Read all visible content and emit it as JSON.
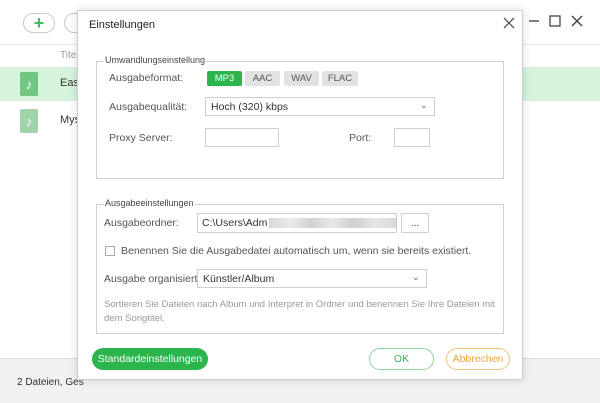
{
  "main": {
    "add_icon": "plus-icon",
    "column_title": "Titel",
    "rows": [
      {
        "name": "Easi",
        "icon": "music-note-icon"
      },
      {
        "name": "Mys",
        "icon": "music-note-icon"
      }
    ],
    "status": "2 Dateien, Ges"
  },
  "dialog": {
    "title": "Einstellungen",
    "close_icon": "close-icon",
    "conversion": {
      "legend": "Umwandlungseinstellung",
      "format_label": "Ausgabeformat:",
      "formats": [
        "MP3",
        "AAC",
        "WAV",
        "FLAC"
      ],
      "selected_format": "MP3",
      "quality_label": "Ausgabequalität:",
      "quality_value": "Hoch (320) kbps",
      "proxy_label": "Proxy Server:",
      "proxy_value": "",
      "port_label": "Port:",
      "port_value": ""
    },
    "output": {
      "legend": "Ausgabeeinstellungen",
      "folder_label": "Ausgabeordner:",
      "folder_value": "C:\\Users\\Adm",
      "browse_label": "...",
      "rename_label": "Benennen Sie die Ausgabedatei automatisch um, wenn sie bereits existiert.",
      "rename_checked": false,
      "organize_label": "Ausgabe organisiert:",
      "organize_value": "Künstler/Album",
      "organize_hint": "Sortieren Sie Dateien nach Album und Interpret in Ordner und benennen Sie Ihre Dateien mit dem Songtitel."
    },
    "buttons": {
      "defaults": "Standardeinstellungen",
      "ok": "OK",
      "cancel": "Abbrechen"
    }
  },
  "colors": {
    "accent": "#2db54d",
    "selected_row": "#d6f3dc",
    "cancel": "#f0a33c"
  }
}
